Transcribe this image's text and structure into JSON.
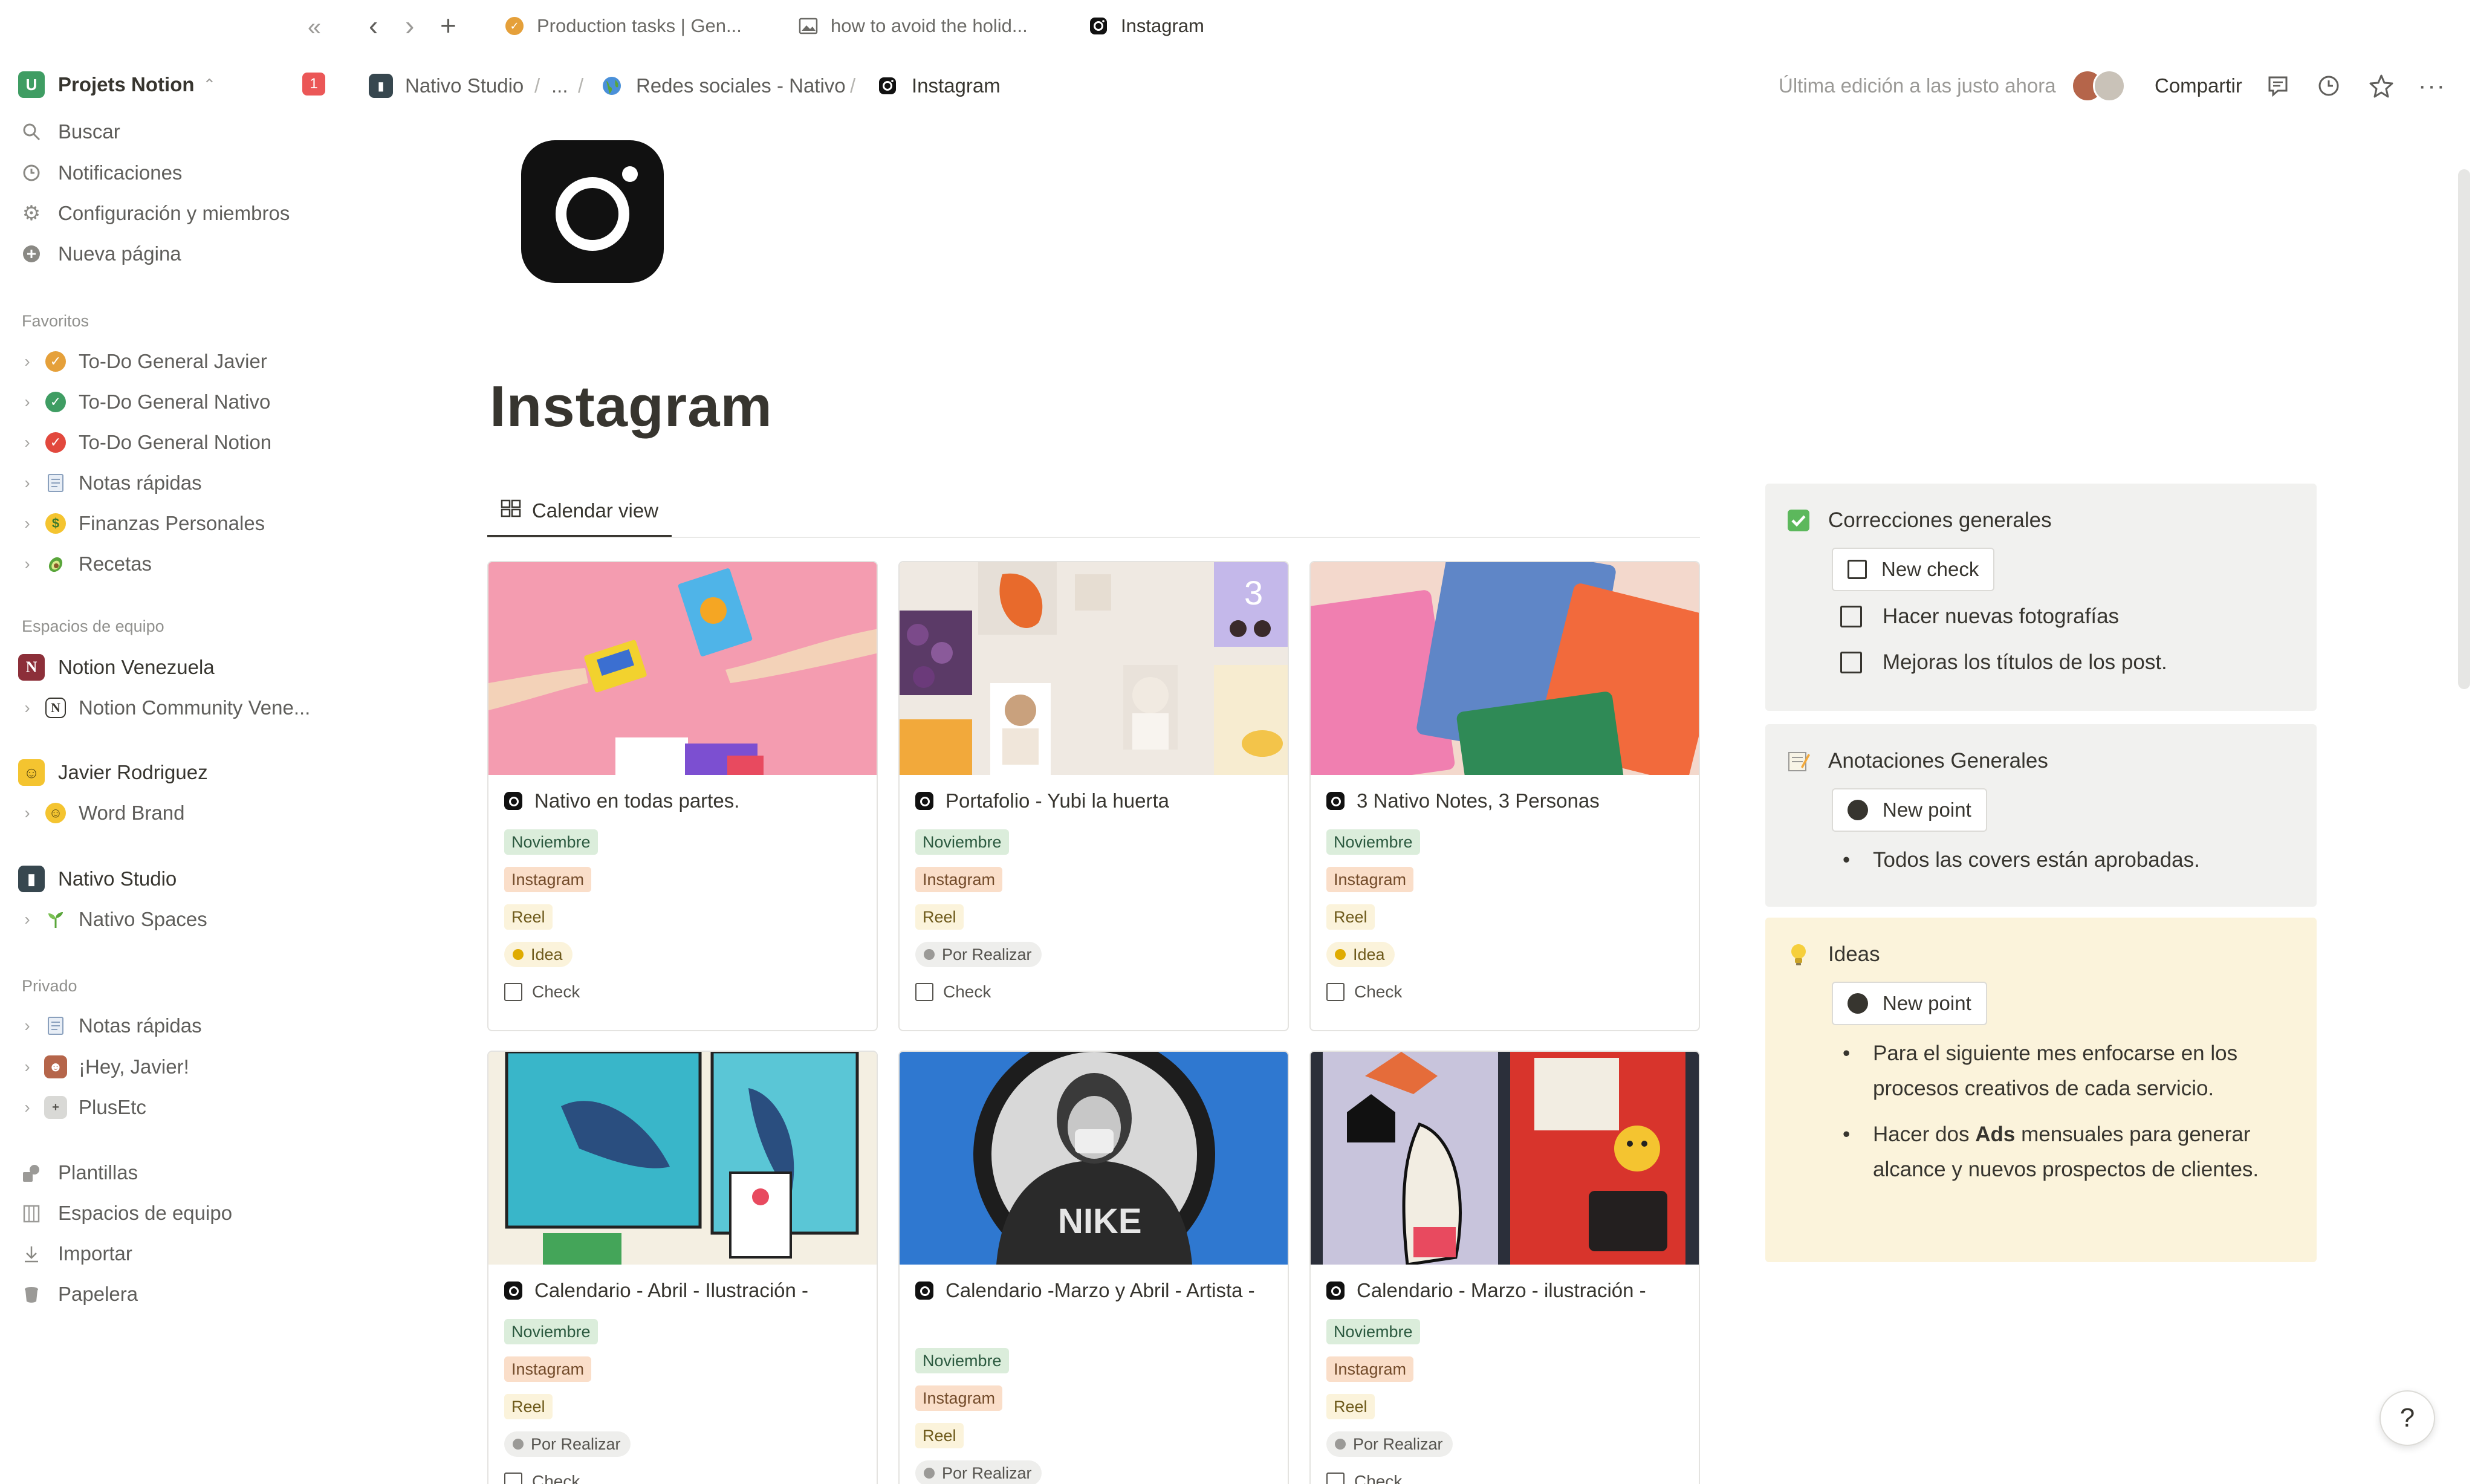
{
  "sidebar": {
    "workspace": "Projets Notion",
    "notif_count": "1",
    "nav": [
      {
        "label": "Buscar",
        "icon": "search-icon"
      },
      {
        "label": "Notificaciones",
        "icon": "clock-icon"
      },
      {
        "label": "Configuración y miembros",
        "icon": "gear-icon"
      },
      {
        "label": "Nueva página",
        "icon": "plus-circle-icon"
      }
    ],
    "favorites_title": "Favoritos",
    "favorites": [
      {
        "label": "To-Do General Javier",
        "icon": "check-circle-orange-icon",
        "color": "#e5a03a"
      },
      {
        "label": "To-Do General Nativo",
        "icon": "check-circle-green-icon",
        "color": "#3f9d63"
      },
      {
        "label": "To-Do General Notion",
        "icon": "check-circle-red-icon",
        "color": "#e2483d"
      },
      {
        "label": "Notas rápidas",
        "icon": "notepad-icon"
      },
      {
        "label": "Finanzas Personales",
        "icon": "money-face-icon"
      },
      {
        "label": "Recetas",
        "icon": "avocado-icon"
      }
    ],
    "team_title": "Espacios de equipo",
    "team": [
      {
        "label": "Notion Venezuela",
        "icon": "notion-logo-icon"
      },
      {
        "label": "Notion Community Vene...",
        "icon": "notion-logo-icon"
      },
      {
        "label": "Javier Rodriguez",
        "icon": "smiley-icon"
      },
      {
        "label": "Word Brand",
        "icon": "smiley-icon"
      },
      {
        "label": "Nativo Studio",
        "icon": "nativo-logo-icon"
      },
      {
        "label": "Nativo Spaces",
        "icon": "sprout-icon"
      }
    ],
    "private_title": "Privado",
    "private": [
      {
        "label": "Notas rápidas",
        "icon": "notepad-icon"
      },
      {
        "label": "¡Hey, Javier!",
        "icon": "avatar-icon"
      },
      {
        "label": "PlusEtc",
        "icon": "plusetc-icon"
      }
    ],
    "bottom": [
      {
        "label": "Plantillas",
        "icon": "shapes-icon"
      },
      {
        "label": "Espacios de equipo",
        "icon": "building-icon"
      },
      {
        "label": "Importar",
        "icon": "download-icon"
      },
      {
        "label": "Papelera",
        "icon": "trash-icon"
      }
    ]
  },
  "tabs": [
    {
      "label": "Production tasks | Gen...",
      "icon": "check-circle-orange-icon"
    },
    {
      "label": "how to avoid the holid...",
      "icon": "image-icon"
    },
    {
      "label": "Instagram",
      "icon": "instagram-icon"
    }
  ],
  "breadcrumb": {
    "items": [
      "Nativo Studio",
      "...",
      "Redes sociales - Nativo",
      "Instagram"
    ]
  },
  "topbar": {
    "edited": "Última edición a las justo ahora",
    "share": "Compartir"
  },
  "page": {
    "title": "Instagram",
    "view_tab": "Calendar view"
  },
  "cards": [
    {
      "title": "Nativo en todas partes.",
      "tags": [
        "Noviembre",
        "Instagram",
        "Reel"
      ],
      "status": "Idea",
      "check": "Check"
    },
    {
      "title": "Portafolio - Yubi la huerta",
      "tags": [
        "Noviembre",
        "Instagram",
        "Reel"
      ],
      "status": "Por Realizar",
      "check": "Check"
    },
    {
      "title": "3 Nativo Notes, 3 Personas",
      "tags": [
        "Noviembre",
        "Instagram",
        "Reel"
      ],
      "status": "Idea",
      "check": "Check"
    },
    {
      "title": "Calendario - Abril - Ilustración -",
      "tags": [
        "Noviembre",
        "Instagram",
        "Reel"
      ],
      "status": "Por Realizar",
      "check": "Check"
    },
    {
      "title": "Calendario -Marzo y Abril - Artista -",
      "tags": [
        "Noviembre",
        "Instagram",
        "Reel"
      ],
      "status": "Por Realizar",
      "check": ""
    },
    {
      "title": "Calendario - Marzo - ilustración -",
      "tags": [
        "Noviembre",
        "Instagram",
        "Reel"
      ],
      "status": "Por Realizar",
      "check": "Check"
    }
  ],
  "callouts": {
    "corrections": {
      "title": "Correcciones generales",
      "button": "New check",
      "items": [
        "Hacer nuevas fotografías",
        "Mejoras los títulos de los post."
      ]
    },
    "notes": {
      "title": "Anotaciones Generales",
      "button": "New point",
      "items": [
        "Todos las covers están aprobadas."
      ]
    },
    "ideas": {
      "title": "Ideas",
      "button": "New point",
      "item1": "Para el siguiente mes enfocarse en los procesos creativos de cada servicio.",
      "item2_a": "Hacer dos ",
      "item2_b": "Ads",
      "item2_c": " mensuales para generar alcance y nuevos prospectos de clientes."
    }
  },
  "help": "?",
  "colors": {
    "accent_red": "#eb5757",
    "tag_green": "#dbeddb",
    "tag_orange": "#fadec9",
    "tag_yellow": "#fbf3db",
    "callout_grey": "#f1f1ef",
    "callout_yellow": "#fbf3db"
  }
}
